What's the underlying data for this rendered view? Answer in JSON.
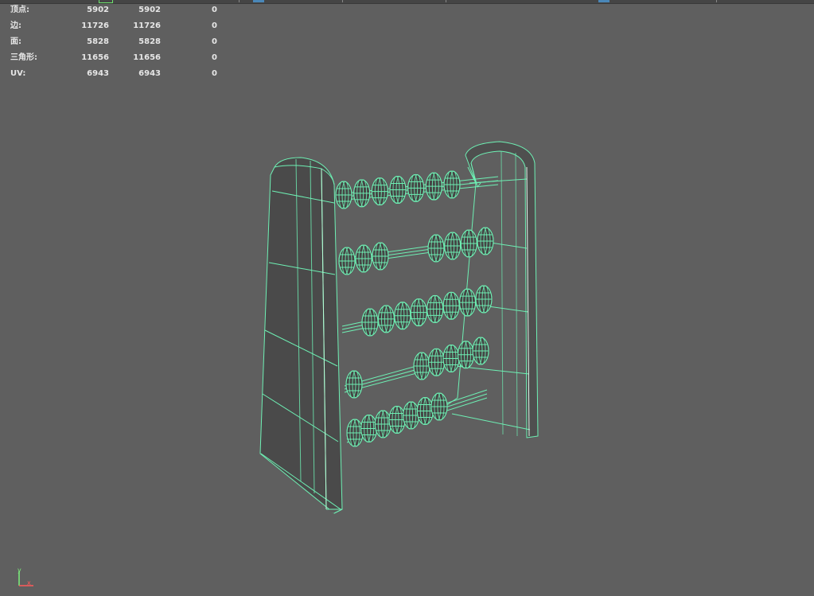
{
  "hud": {
    "rows": [
      {
        "label": "顶点:",
        "v1": "5902",
        "v2": "5902",
        "v3": "0"
      },
      {
        "label": "边:",
        "v1": "11726",
        "v2": "11726",
        "v3": "0"
      },
      {
        "label": "面:",
        "v1": "5828",
        "v2": "5828",
        "v3": "0"
      },
      {
        "label": "三角形:",
        "v1": "11656",
        "v2": "11656",
        "v3": "0"
      },
      {
        "label": "UV:",
        "v1": "6943",
        "v2": "6943",
        "v3": "0"
      }
    ]
  },
  "axis": {
    "y_label": "y",
    "x_label": "x"
  },
  "colors": {
    "background": "#5f5f5f",
    "wireframe": "#6ef0b4",
    "solid": "#4a4a4a",
    "axis_y": "#7cf07c",
    "axis_x": "#ff5a5a"
  },
  "model": {
    "name_icon": "abacus-wireframe",
    "rods": 5
  }
}
